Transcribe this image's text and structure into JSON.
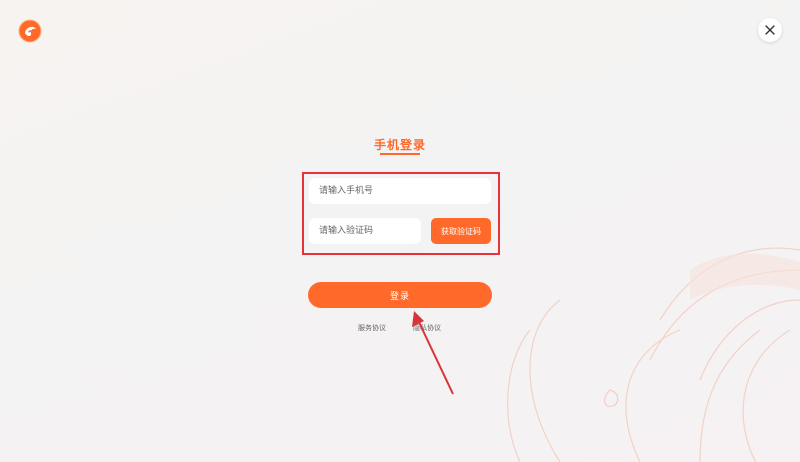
{
  "colors": {
    "accent": "#ff6a2a",
    "highlight_border": "#e8323a",
    "annotation_arrow": "#d8353a"
  },
  "header": {
    "logo_icon": "phoenix-logo-icon",
    "close_icon": "close-icon"
  },
  "login": {
    "title": "手机登录",
    "phone_placeholder": "请输入手机号",
    "code_placeholder": "请输入验证码",
    "get_code_label": "获取验证码",
    "submit_label": "登录"
  },
  "links": {
    "service": "服务协议",
    "privacy": "隐私协议"
  }
}
